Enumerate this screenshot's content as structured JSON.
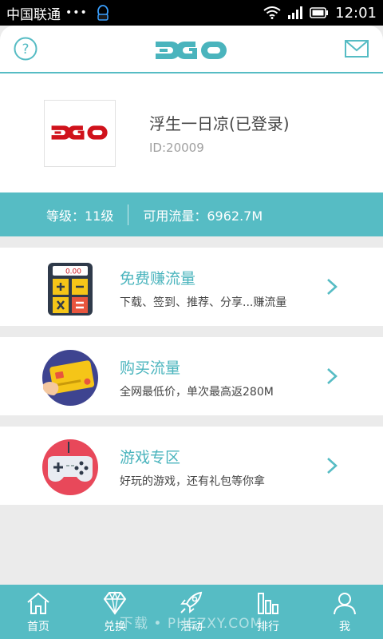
{
  "status_bar": {
    "carrier": "中国联通",
    "dots": "•••",
    "time": "12:01"
  },
  "header": {
    "logo_text": "JGO"
  },
  "profile": {
    "username": "浮生一日凉(已登录)",
    "user_id": "ID:20009"
  },
  "stats": {
    "level": "等级：11级",
    "traffic": "可用流量：6962.7M"
  },
  "menu": [
    {
      "title": "免费赚流量",
      "desc": "下载、签到、推荐、分享...赚流量",
      "icon": "calculator-icon"
    },
    {
      "title": "购买流量",
      "desc": "全网最低价，单次最高返280M",
      "icon": "credit-card-icon"
    },
    {
      "title": "游戏专区",
      "desc": "好玩的游戏，还有礼包等你拿",
      "icon": "gamepad-icon"
    }
  ],
  "calculator_display": "0.00",
  "bottom_nav": [
    {
      "label": "首页",
      "icon": "home-icon"
    },
    {
      "label": "兑换",
      "icon": "diamond-icon"
    },
    {
      "label": "活动",
      "icon": "rocket-icon"
    },
    {
      "label": "排行",
      "icon": "bar-chart-icon"
    },
    {
      "label": "我",
      "icon": "user-icon"
    }
  ],
  "watermark": "下载 • PHEZXY.COM",
  "colors": {
    "accent": "#56bcc4",
    "title_teal": "#4ab4bd",
    "logo_red": "#d0121b"
  }
}
